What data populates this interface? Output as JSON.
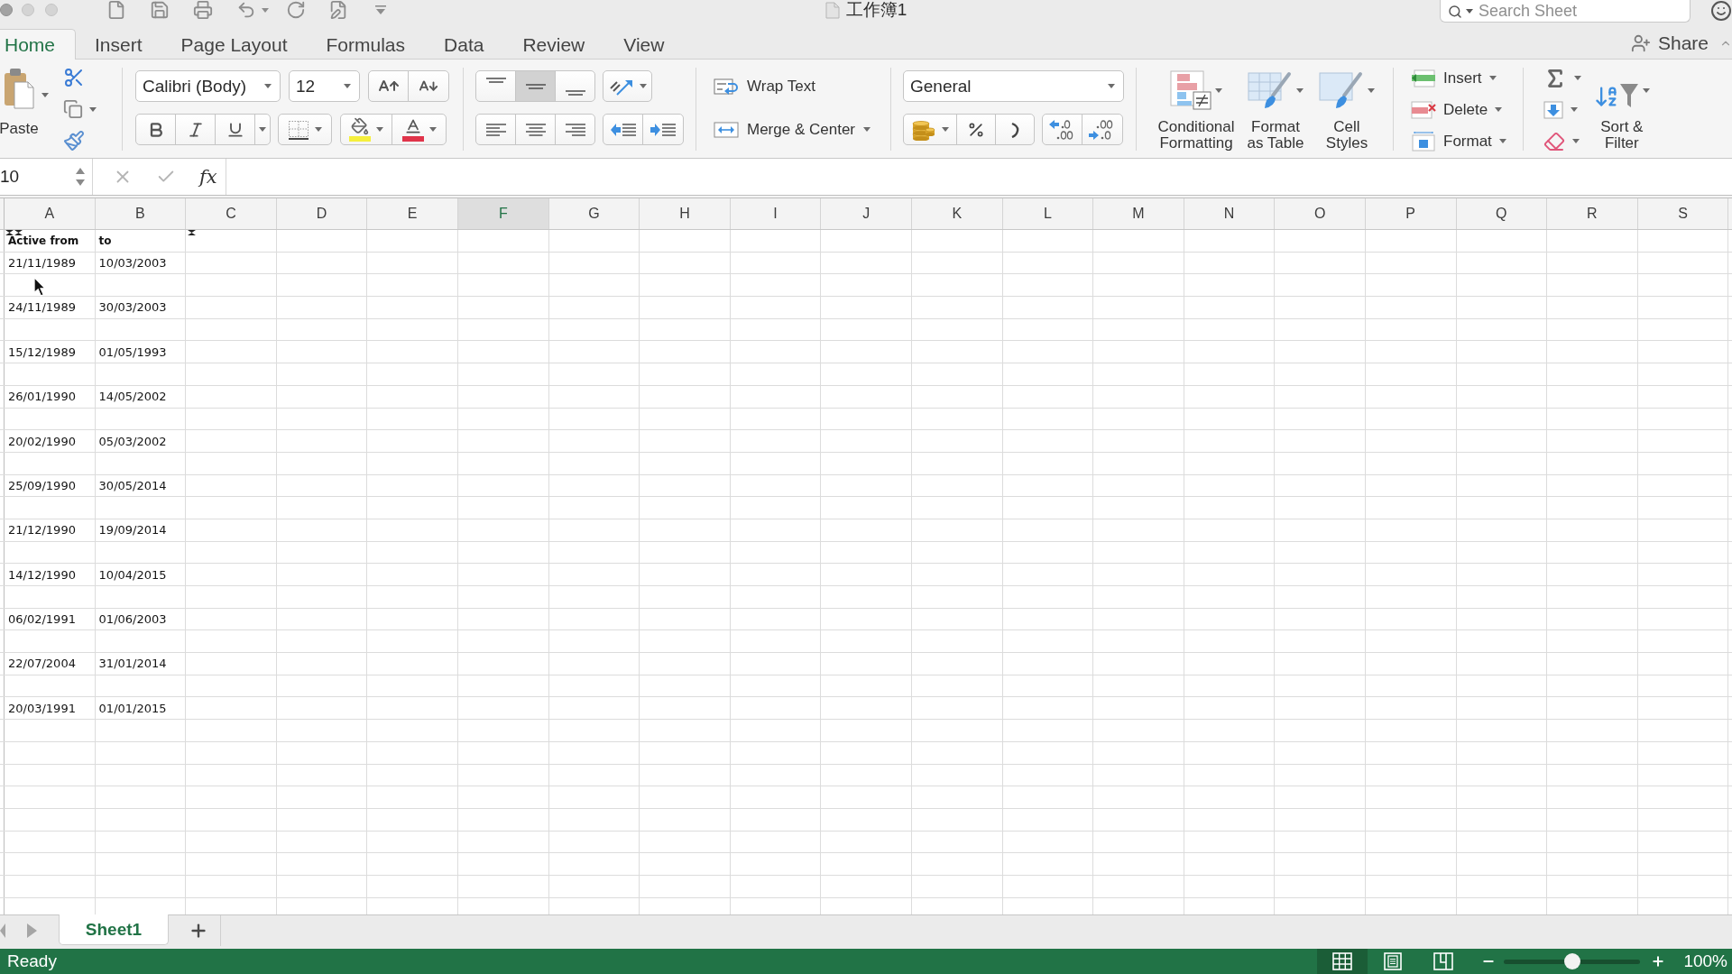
{
  "window": {
    "title": "工作簿1"
  },
  "search": {
    "placeholder": "Search Sheet"
  },
  "ribbon_tabs": [
    {
      "label": "Home",
      "selected": true
    },
    {
      "label": "Insert",
      "selected": false
    },
    {
      "label": "Page Layout",
      "selected": false
    },
    {
      "label": "Formulas",
      "selected": false
    },
    {
      "label": "Data",
      "selected": false
    },
    {
      "label": "Review",
      "selected": false
    },
    {
      "label": "View",
      "selected": false
    }
  ],
  "share": {
    "label": "Share"
  },
  "clipboard": {
    "paste_label": "Paste"
  },
  "font": {
    "name": "Calibri (Body)",
    "size": "12",
    "styles": [
      {
        "kind": "bold",
        "on": false
      },
      {
        "kind": "italic",
        "on": false
      },
      {
        "kind": "underline",
        "on": false
      }
    ]
  },
  "alignment": {
    "vertical": [
      {
        "kind": "top",
        "selected": false
      },
      {
        "kind": "middle",
        "selected": true
      },
      {
        "kind": "bottom",
        "selected": false
      }
    ],
    "horizontal": [
      {
        "kind": "left",
        "selected": false
      },
      {
        "kind": "center",
        "selected": false
      },
      {
        "kind": "right",
        "selected": false
      }
    ],
    "wrap_text_label": "Wrap Text",
    "merge_label": "Merge & Center"
  },
  "number": {
    "format": "General"
  },
  "styles": [
    {
      "kind": "conditional",
      "label": "Conditional Formatting"
    },
    {
      "kind": "table",
      "label": "Format as Table"
    },
    {
      "kind": "cell",
      "label": "Cell Styles"
    }
  ],
  "cells": [
    {
      "kind": "insert",
      "label": "Insert"
    },
    {
      "kind": "delete",
      "label": "Delete"
    },
    {
      "kind": "format",
      "label": "Format"
    }
  ],
  "editing": {
    "sort_filter_label": "Sort & Filter"
  },
  "formula_bar": {
    "name_box": "10",
    "function_label": "fx"
  },
  "columns": [
    {
      "label": "A",
      "selected": false
    },
    {
      "label": "B",
      "selected": false
    },
    {
      "label": "C",
      "selected": false
    },
    {
      "label": "D",
      "selected": false
    },
    {
      "label": "E",
      "selected": false
    },
    {
      "label": "F",
      "selected": true
    },
    {
      "label": "G",
      "selected": false
    },
    {
      "label": "H",
      "selected": false
    },
    {
      "label": "I",
      "selected": false
    },
    {
      "label": "J",
      "selected": false
    },
    {
      "label": "K",
      "selected": false
    },
    {
      "label": "L",
      "selected": false
    },
    {
      "label": "M",
      "selected": false
    },
    {
      "label": "N",
      "selected": false
    },
    {
      "label": "O",
      "selected": false
    },
    {
      "label": "P",
      "selected": false
    },
    {
      "label": "Q",
      "selected": false
    },
    {
      "label": "R",
      "selected": false
    },
    {
      "label": "S",
      "selected": false
    }
  ],
  "sheet_rows": [
    {
      "kind": "header",
      "cells": [
        "Active from",
        "to"
      ]
    },
    {
      "kind": "data",
      "cells": [
        "21/11/1989",
        "10/03/2003"
      ]
    },
    {
      "kind": "blank"
    },
    {
      "kind": "data",
      "cells": [
        "24/11/1989",
        "30/03/2003"
      ]
    },
    {
      "kind": "blank"
    },
    {
      "kind": "data",
      "cells": [
        "15/12/1989",
        "01/05/1993"
      ]
    },
    {
      "kind": "blank"
    },
    {
      "kind": "data",
      "cells": [
        "26/01/1990",
        "14/05/2002"
      ]
    },
    {
      "kind": "blank"
    },
    {
      "kind": "data",
      "cells": [
        "20/02/1990",
        "05/03/2002"
      ]
    },
    {
      "kind": "blank"
    },
    {
      "kind": "data",
      "cells": [
        "25/09/1990",
        "30/05/2014"
      ]
    },
    {
      "kind": "blank"
    },
    {
      "kind": "data",
      "cells": [
        "21/12/1990",
        "19/09/2014"
      ]
    },
    {
      "kind": "blank"
    },
    {
      "kind": "data",
      "cells": [
        "14/12/1990",
        "10/04/2015"
      ]
    },
    {
      "kind": "blank"
    },
    {
      "kind": "data",
      "cells": [
        "06/02/1991",
        "01/06/2003"
      ]
    },
    {
      "kind": "blank"
    },
    {
      "kind": "data",
      "cells": [
        "22/07/2004",
        "31/01/2014"
      ]
    },
    {
      "kind": "blank"
    },
    {
      "kind": "data",
      "cells": [
        "20/03/1991",
        "01/01/2015"
      ]
    }
  ],
  "sheet_tabs": [
    {
      "label": "Sheet1",
      "selected": true
    }
  ],
  "status_bar": {
    "text": "Ready",
    "views": [
      {
        "kind": "normal",
        "selected": true
      },
      {
        "kind": "page_layout",
        "selected": false
      },
      {
        "kind": "page_break",
        "selected": false
      }
    ],
    "zoom": {
      "level": 0.5,
      "reading": "100%"
    }
  }
}
